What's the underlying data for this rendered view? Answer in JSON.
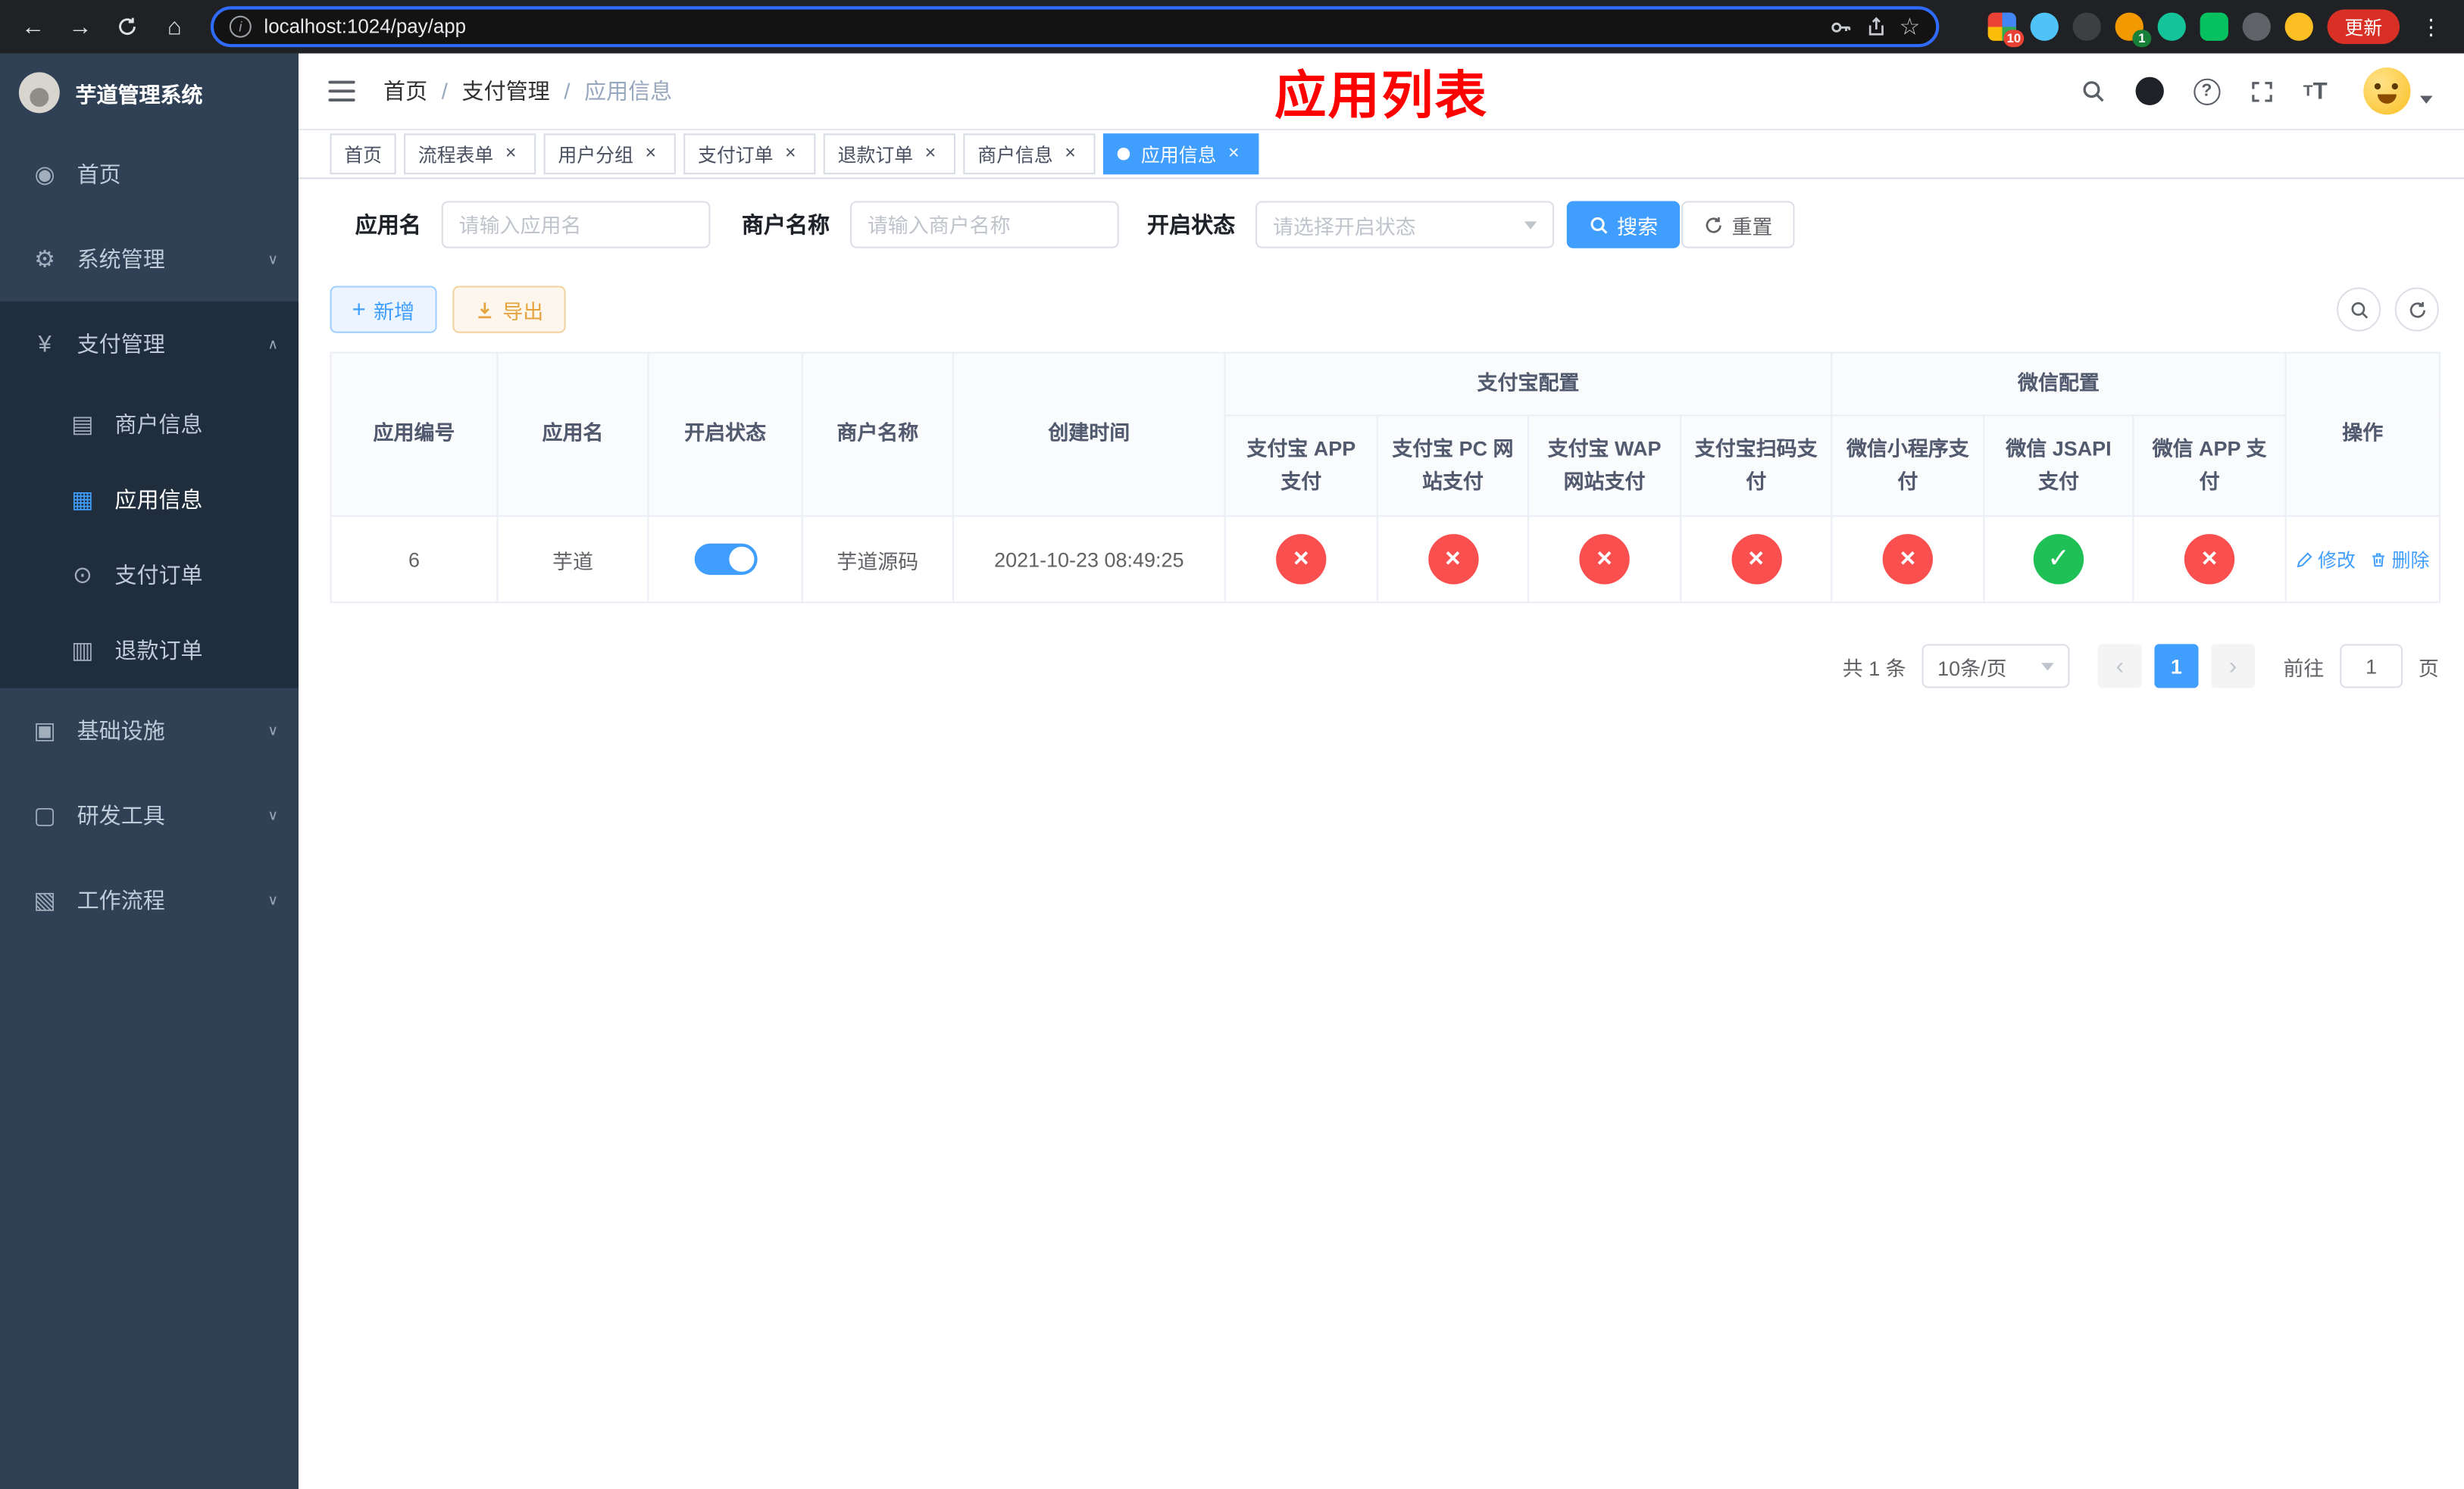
{
  "colors": {
    "accent": "#409eff",
    "danger_circle": "#f9504f",
    "success_circle": "#1fc157",
    "page_title_red": "#ff0000",
    "sidebar_bg": "#304156",
    "submenu_bg": "#1f2d3d"
  },
  "browser": {
    "url": "localhost:1024/pay/app",
    "update_button": "更新",
    "extension_badge_1": "10",
    "extension_badge_2": "1"
  },
  "sidebar": {
    "title": "芋道管理系统",
    "items": [
      {
        "label": "首页",
        "icon": "dashboard-icon"
      },
      {
        "label": "系统管理",
        "icon": "gear-icon",
        "chevron": "down"
      },
      {
        "label": "支付管理",
        "icon": "yen-icon",
        "chevron": "up"
      },
      {
        "label": "商户信息",
        "icon": "merchant-card-icon"
      },
      {
        "label": "应用信息",
        "icon": "app-grid-icon",
        "active": true
      },
      {
        "label": "支付订单",
        "icon": "pay-order-icon"
      },
      {
        "label": "退款订单",
        "icon": "refund-order-icon"
      },
      {
        "label": "基础设施",
        "icon": "infra-icon",
        "chevron": "down"
      },
      {
        "label": "研发工具",
        "icon": "devtools-icon",
        "chevron": "down"
      },
      {
        "label": "工作流程",
        "icon": "workflow-icon",
        "chevron": "down"
      }
    ]
  },
  "navbar": {
    "breadcrumb": [
      {
        "label": "首页"
      },
      {
        "label": "支付管理"
      },
      {
        "label": "应用信息"
      }
    ],
    "page_title": "应用列表"
  },
  "tabs": [
    {
      "label": "首页",
      "closable": false
    },
    {
      "label": "流程表单",
      "closable": true
    },
    {
      "label": "用户分组",
      "closable": true
    },
    {
      "label": "支付订单",
      "closable": true
    },
    {
      "label": "退款订单",
      "closable": true
    },
    {
      "label": "商户信息",
      "closable": true
    },
    {
      "label": "应用信息",
      "closable": true,
      "active": true
    }
  ],
  "filters": {
    "app_name": {
      "label": "应用名",
      "placeholder": "请输入应用名"
    },
    "merchant_name": {
      "label": "商户名称",
      "placeholder": "请输入商户名称"
    },
    "status": {
      "label": "开启状态",
      "placeholder": "请选择开启状态"
    },
    "search_button": "搜索",
    "reset_button": "重置"
  },
  "toolbar": {
    "add_button": "新增",
    "export_button": "导出"
  },
  "table": {
    "col_headers": [
      "应用编号",
      "应用名",
      "开启状态",
      "商户名称",
      "创建时间"
    ],
    "groups": [
      {
        "label": "支付宝配置",
        "span": 4
      },
      {
        "label": "微信配置",
        "span": 3
      }
    ],
    "sub_headers": [
      "支付宝 APP 支付",
      "支付宝 PC 网站支付",
      "支付宝 WAP 网站支付",
      "支付宝扫码支付",
      "微信小程序支付",
      "微信 JSAPI 支付",
      "微信 APP 支付"
    ],
    "action_header": "操作",
    "row": {
      "id": "6",
      "name": "芋道",
      "enabled": true,
      "merchant": "芋道源码",
      "created": "2021-10-23 08:49:25",
      "configs": [
        false,
        false,
        false,
        false,
        false,
        true,
        false
      ],
      "edit_label": "修改",
      "delete_label": "删除"
    }
  },
  "pagination": {
    "total_text": "共 1 条",
    "page_size": "10条/页",
    "current_page": "1",
    "goto_label": "前往",
    "goto_value": "1",
    "goto_unit": "页"
  }
}
